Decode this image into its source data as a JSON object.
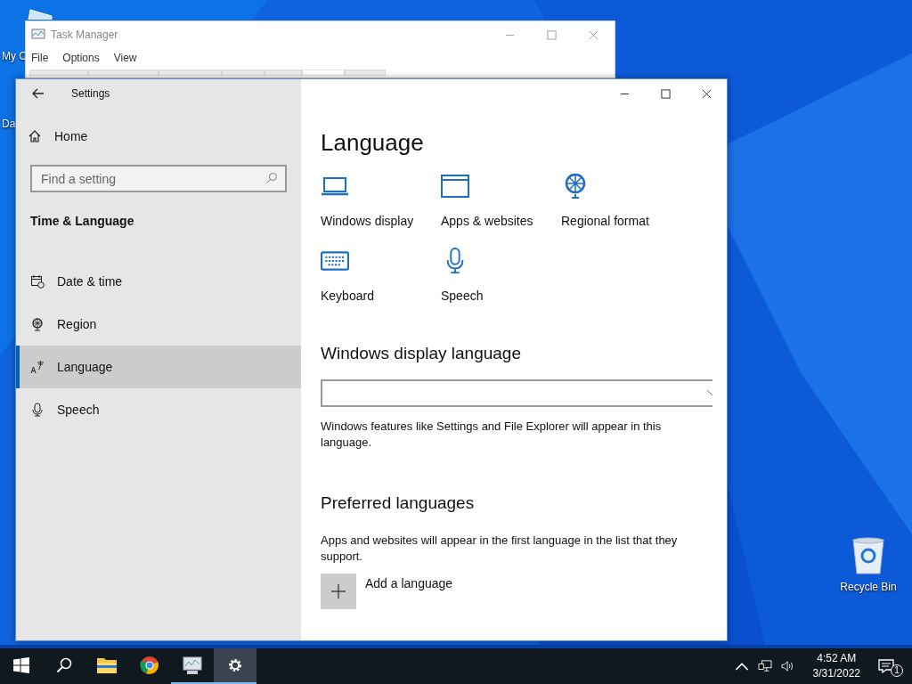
{
  "desktop_icons": [
    {
      "label": "My C"
    },
    {
      "label": "Da"
    },
    {
      "label": "Recycle Bin"
    }
  ],
  "task_manager": {
    "title": "Task Manager",
    "menu": [
      "File",
      "Options",
      "View"
    ]
  },
  "settings": {
    "title": "Settings",
    "home": "Home",
    "search": {
      "placeholder": "Find a setting"
    },
    "section": "Time & Language",
    "nav": [
      {
        "label": "Date & time",
        "selected": false
      },
      {
        "label": "Region",
        "selected": false
      },
      {
        "label": "Language",
        "selected": true
      },
      {
        "label": "Speech",
        "selected": false
      }
    ],
    "page_title": "Language",
    "tiles": [
      {
        "label": "Windows display"
      },
      {
        "label": "Apps & websites"
      },
      {
        "label": "Regional format"
      },
      {
        "label": "Keyboard"
      },
      {
        "label": "Speech"
      }
    ],
    "display_language": {
      "heading": "Windows display language",
      "description": "Windows features like Settings and File Explorer will appear in this language."
    },
    "preferred": {
      "heading": "Preferred languages",
      "description": "Apps and websites will appear in the first language in the list that they support.",
      "add_label": "Add a language"
    }
  },
  "taskbar": {
    "apps": [
      {
        "running": false,
        "selected": false
      },
      {
        "running": false,
        "selected": false
      },
      {
        "running": false,
        "selected": false
      },
      {
        "running": true,
        "selected": false
      },
      {
        "running": true,
        "selected": true
      }
    ],
    "time": "4:52 AM",
    "date": "3/31/2022",
    "notification_count": "1"
  }
}
